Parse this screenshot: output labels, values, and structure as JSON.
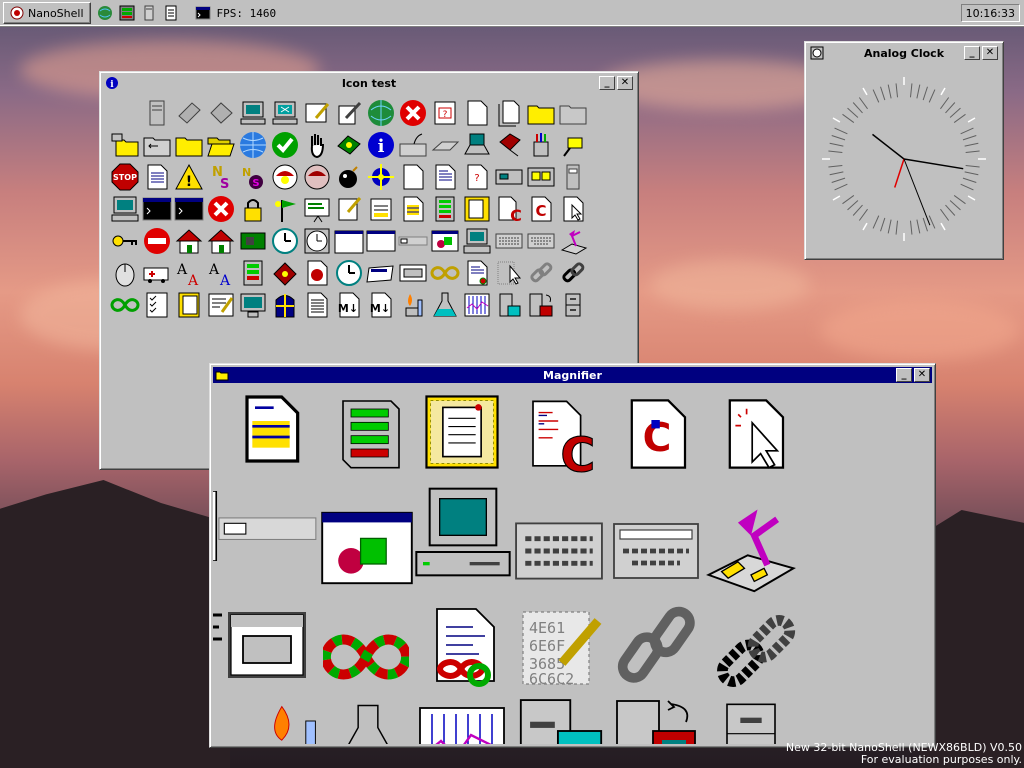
{
  "taskbar": {
    "start_label": "NanoShell",
    "fps_label": "FPS: 1460",
    "clock": "10:16:33"
  },
  "windows": {
    "icon_test": {
      "title": "Icon test"
    },
    "analog_clock": {
      "title": "Analog Clock"
    },
    "magnifier": {
      "title": "Magnifier"
    }
  },
  "window_buttons": {
    "minimize": "_",
    "close": "✕"
  },
  "watermark": {
    "line1": "New 32-bit NanoShell (NEWX86BLD) V0.50",
    "line2": "For evaluation purposes only."
  },
  "icons": {
    "row1": [
      "server-icon",
      "drive-icon",
      "drive-icon",
      "computer-icon",
      "network-computer-icon",
      "paint-icon",
      "pen-icon",
      "globe-icon",
      "error-icon",
      "help-document-icon",
      "document-icon",
      "documents-icon",
      "folder-icon",
      "folder-gray-icon"
    ],
    "stop_text": "STOP"
  },
  "colors": {
    "title_active": "#000080",
    "window_face": "#c0c0c0",
    "desktop_sky": "#d7826f"
  }
}
